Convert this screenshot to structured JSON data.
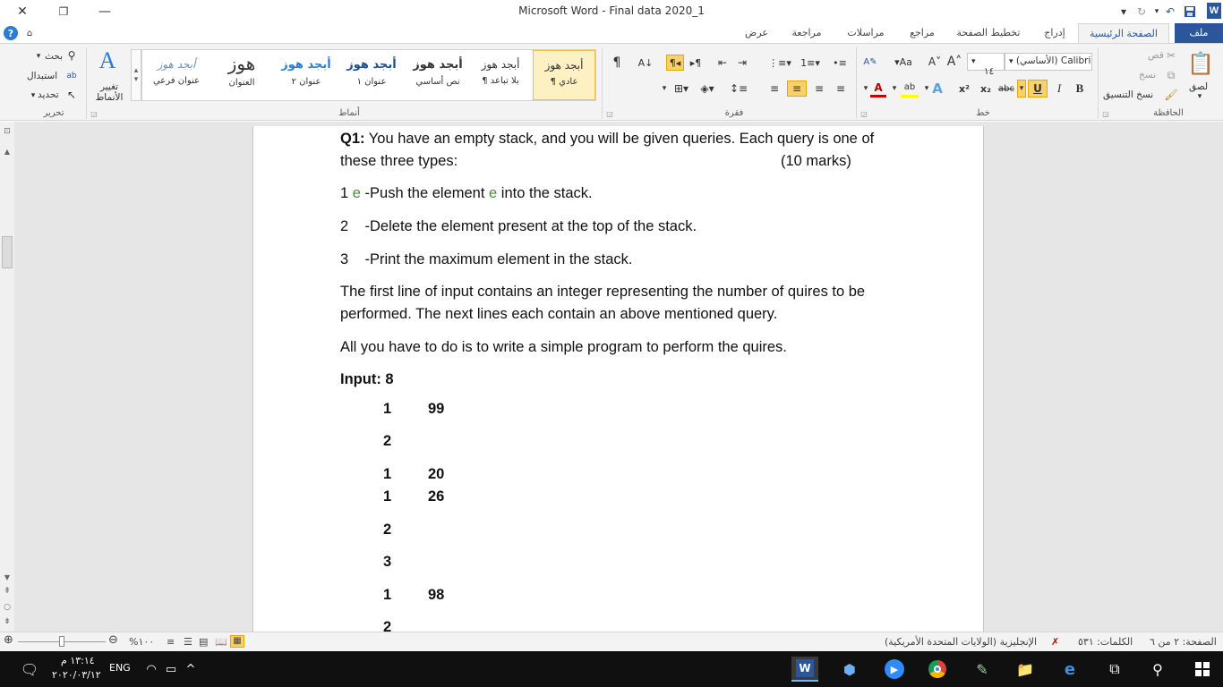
{
  "window": {
    "title": "Microsoft Word  -  Final data 2020_1",
    "close": "✕",
    "restore": "❐",
    "minimize": "—",
    "app_logo": "W"
  },
  "tabs": {
    "file": "ملف",
    "home": "الصفحة الرئيسية",
    "insert": "إدراج",
    "layout": "تخطيط الصفحة",
    "references": "مراجع",
    "mailings": "مراسلات",
    "review": "مراجعة",
    "view": "عرض"
  },
  "clipboard": {
    "paste": "لصق",
    "cut": "قص",
    "copy": "نسخ",
    "format_painter": "نسخ التنسيق",
    "group_label": "الحافظة"
  },
  "font": {
    "name": "(الأساسي) Calibri",
    "size": "١٤",
    "group_label": "خط"
  },
  "paragraph": {
    "group_label": "فقرة"
  },
  "styles": {
    "group_label": "أنماط",
    "change_styles": "تغيير الأنماط",
    "items": [
      {
        "sample": "أبجد هوز",
        "name": "¶ عادي"
      },
      {
        "sample": "أبجد هوز",
        "name": "¶ بلا تباعد"
      },
      {
        "sample": "أبجد هوز",
        "name": "نص أساسي"
      },
      {
        "sample": "أبجد هوز",
        "name": "عنوان ١"
      },
      {
        "sample": "أبجد هوز",
        "name": "عنوان ٢"
      },
      {
        "sample": "هوز",
        "name": "العنوان"
      },
      {
        "sample": "أبجد هوز",
        "name": "عنوان فرعي"
      }
    ]
  },
  "editing": {
    "find": "بحث",
    "replace": "استبدال",
    "select": "تحديد",
    "group_label": "تحرير"
  },
  "document": {
    "q1_label": "Q1:",
    "q1_line1": " You have an empty stack, and you will be given queries. Each query is one of",
    "q1_line2": "these three types:",
    "marks": "(10 marks)",
    "item1_num": "1 ",
    "item1_e1": "e",
    "item1_mid": " -Push the element ",
    "item1_e2": "e",
    "item1_end": " into the stack.",
    "item2": "2    -Delete the element present at the top of the stack.",
    "item3": "3    -Print the maximum element in the stack.",
    "para1_line1": "The first line of input contains an integer representing the number of quires to be",
    "para1_line2": "performed. The next lines each contain an above mentioned query.",
    "para2": "All you have to do is to write a simple program to perform the quires.",
    "input_label": "Input: 8",
    "queries": [
      {
        "type": "1",
        "value": "99"
      },
      {
        "type": "2",
        "value": ""
      },
      {
        "type": "1",
        "value": "20"
      },
      {
        "type": "1",
        "value": "26"
      },
      {
        "type": "2",
        "value": ""
      },
      {
        "type": "3",
        "value": ""
      },
      {
        "type": "1",
        "value": "98"
      },
      {
        "type": "2",
        "value": ""
      }
    ]
  },
  "status": {
    "page": "الصفحة: ٢ من ٦",
    "words": "الكلمات: ٥٣١",
    "language": "الإنجليزية (الولايات المتحدة الأمريكية)",
    "zoom": "%١٠٠"
  },
  "taskbar": {
    "language": "ENG",
    "time": "١٣:١٤ م",
    "date": "٢٠٢٠/٠٣/١٢"
  }
}
